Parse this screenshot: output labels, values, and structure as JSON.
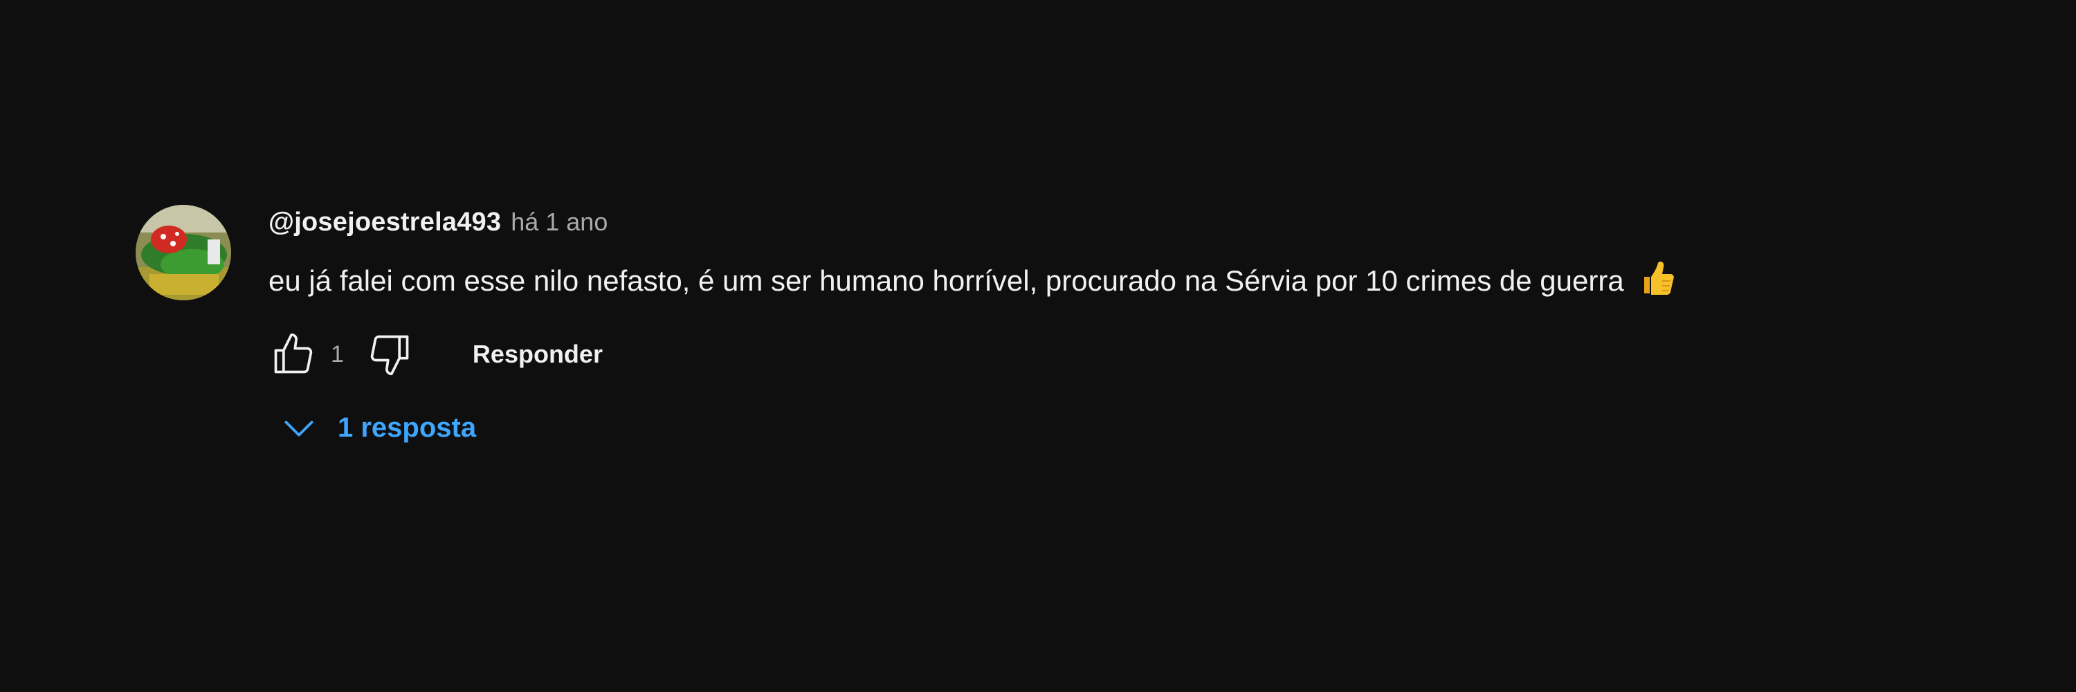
{
  "comment": {
    "author": "@josejoestrela493",
    "timestamp": "há 1 ano",
    "text": "eu já falei com esse nilo nefasto, é um ser humano horrível, procurado na Sérvia por 10 crimes de guerra",
    "emoji": "thumbs-up-emoji",
    "avatar_icon": "avatar-image",
    "like_count": "1",
    "reply_label": "Responder",
    "replies_label": "1 resposta",
    "icons": {
      "like": "thumb-up-icon",
      "dislike": "thumb-down-icon",
      "expand": "chevron-down-icon"
    }
  },
  "colors": {
    "background": "#0f0f0f",
    "text": "#f1f1f1",
    "secondary_text": "#aaaaaa",
    "link_blue": "#3ea6ff"
  }
}
